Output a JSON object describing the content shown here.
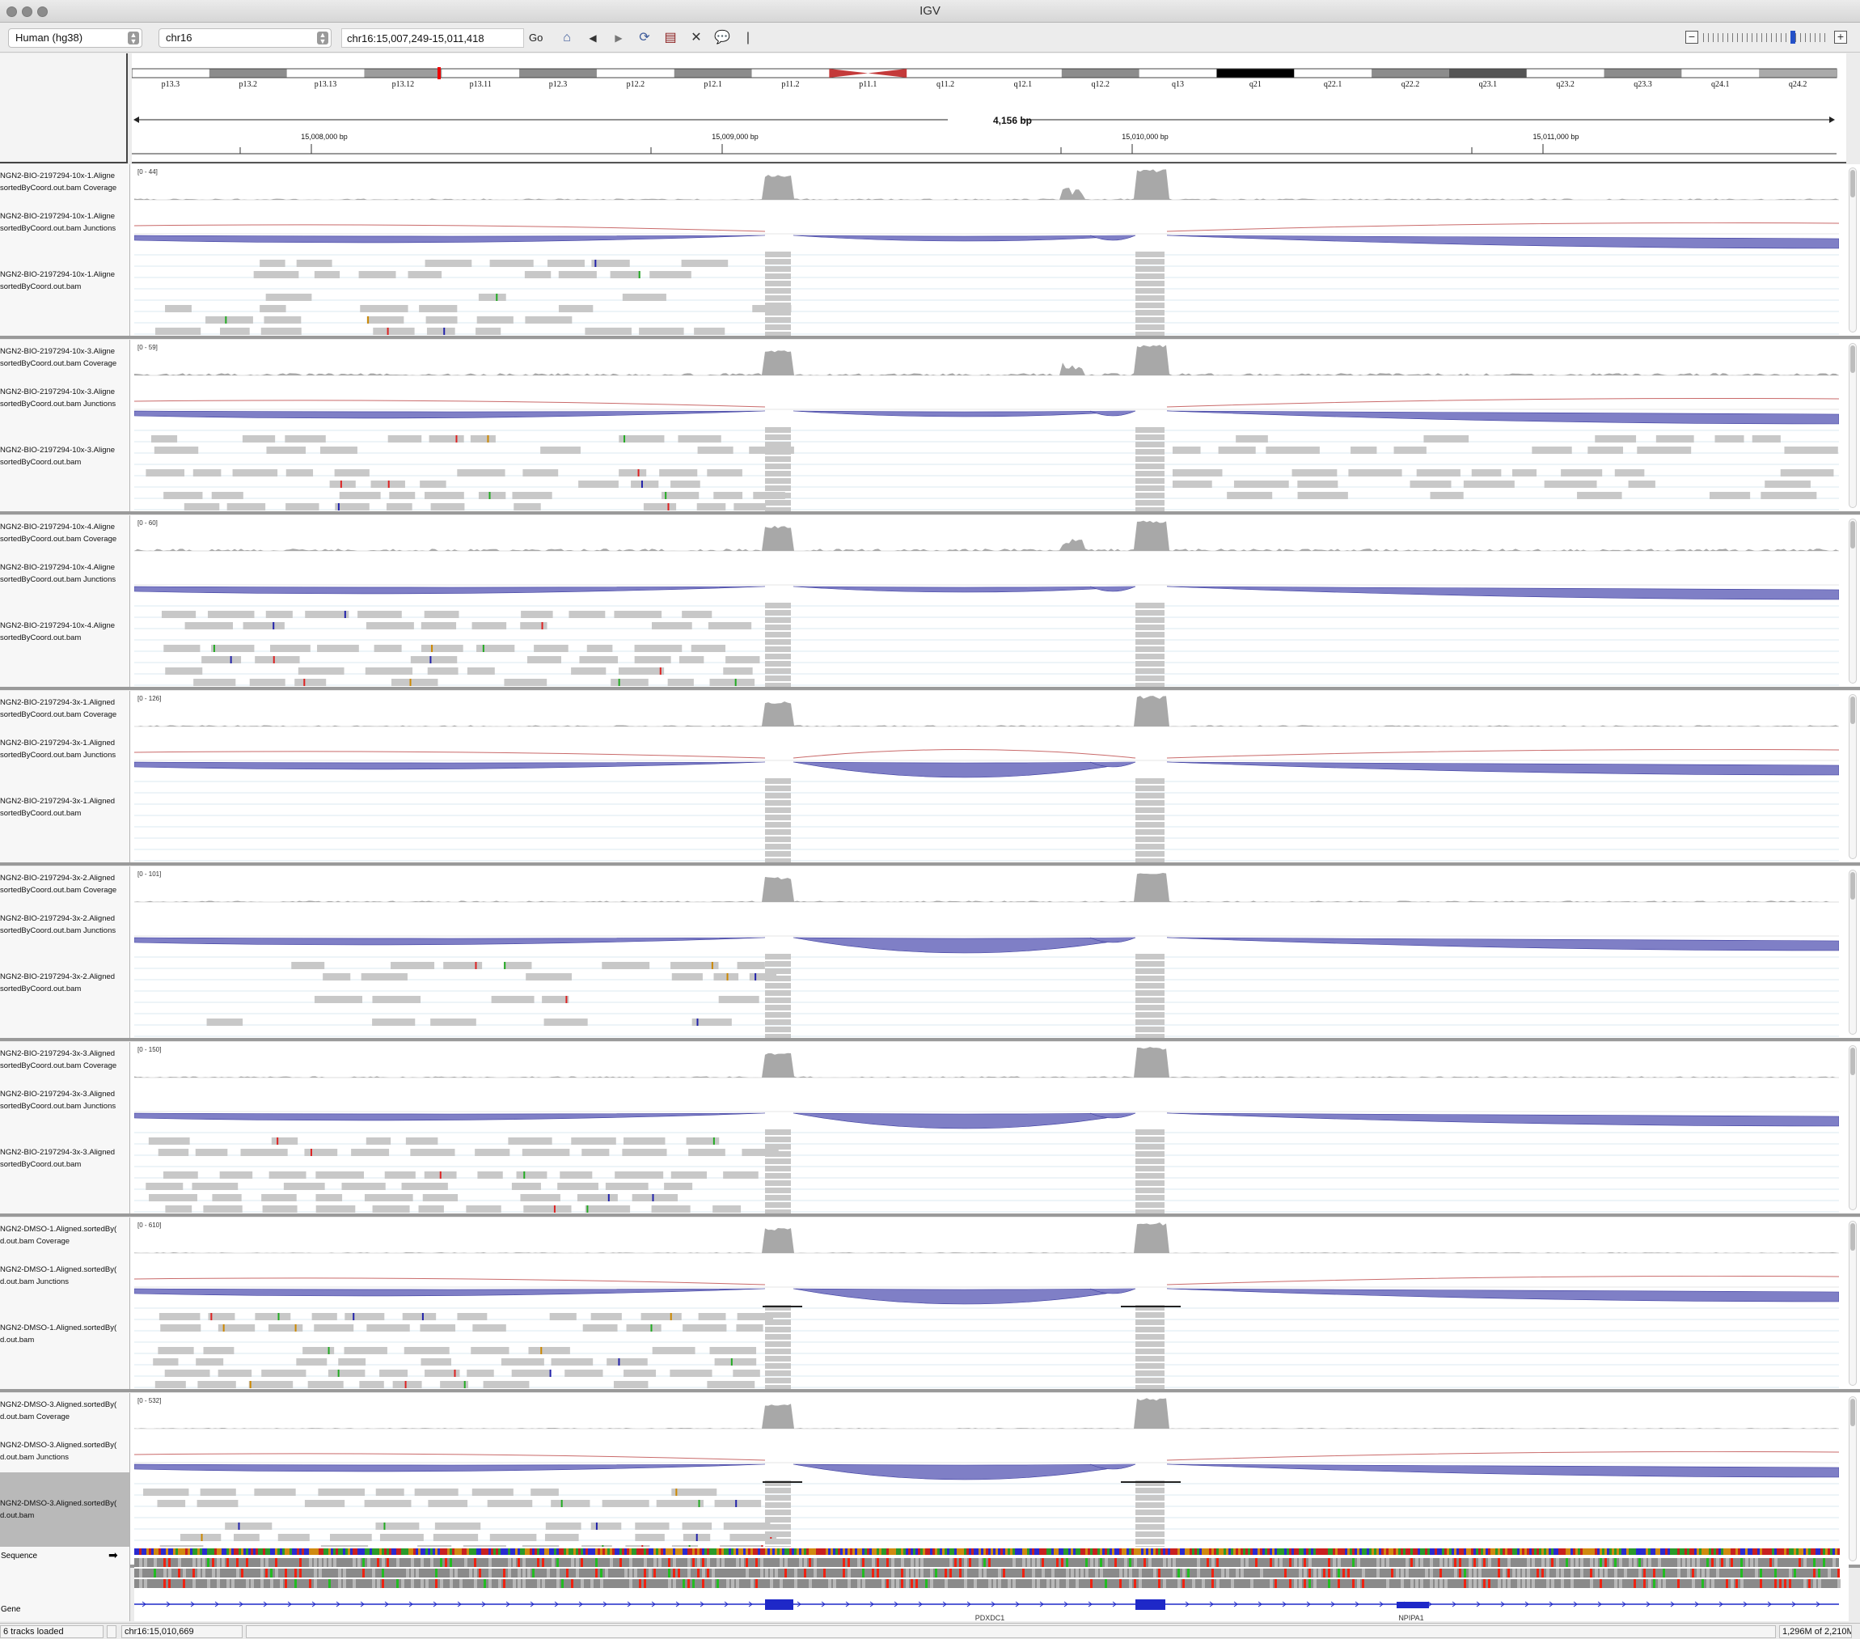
{
  "window": {
    "title": "IGV"
  },
  "toolbar": {
    "genome": "Human (hg38)",
    "chromosome": "chr16",
    "locus": "chr16:15,007,249-15,011,418",
    "go_label": "Go"
  },
  "ideogram": {
    "bands": [
      "p13.3",
      "p13.2",
      "p13.13",
      "p13.12",
      "p13.11",
      "p12.3",
      "p12.2",
      "p12.1",
      "p11.2",
      "p11.1",
      "q11.2",
      "q12.1",
      "q12.2",
      "q13",
      "q21",
      "q22.1",
      "q22.2",
      "q23.1",
      "q23.2",
      "q23.3",
      "q24.1",
      "q24.2"
    ],
    "span_label": "4,156 bp",
    "ticks": [
      "15,008,000 bp",
      "15,009,000 bp",
      "15,010,000 bp",
      "15,011,000 bp"
    ]
  },
  "panels": [
    {
      "range": "[0 - 44]",
      "coverage_name": [
        "NGN2-BIO-2197294-10x-1.Aligne",
        "sortedByCoord.out.bam Coverage"
      ],
      "junctions_name": [
        "NGN2-BIO-2197294-10x-1.Aligne",
        "sortedByCoord.out.bam Junctions"
      ],
      "bam_name": [
        "NGN2-BIO-2197294-10x-1.Aligne",
        "sortedByCoord.out.bam"
      ]
    },
    {
      "range": "[0 - 59]",
      "coverage_name": [
        "NGN2-BIO-2197294-10x-3.Aligne",
        "sortedByCoord.out.bam Coverage"
      ],
      "junctions_name": [
        "NGN2-BIO-2197294-10x-3.Aligne",
        "sortedByCoord.out.bam Junctions"
      ],
      "bam_name": [
        "NGN2-BIO-2197294-10x-3.Aligne",
        "sortedByCoord.out.bam"
      ]
    },
    {
      "range": "[0 - 60]",
      "coverage_name": [
        "NGN2-BIO-2197294-10x-4.Aligne",
        "sortedByCoord.out.bam Coverage"
      ],
      "junctions_name": [
        "NGN2-BIO-2197294-10x-4.Aligne",
        "sortedByCoord.out.bam Junctions"
      ],
      "bam_name": [
        "NGN2-BIO-2197294-10x-4.Aligne",
        "sortedByCoord.out.bam"
      ]
    },
    {
      "range": "[0 - 126]",
      "coverage_name": [
        "NGN2-BIO-2197294-3x-1.Aligned",
        "sortedByCoord.out.bam Coverage"
      ],
      "junctions_name": [
        "NGN2-BIO-2197294-3x-1.Aligned",
        "sortedByCoord.out.bam Junctions"
      ],
      "bam_name": [
        "NGN2-BIO-2197294-3x-1.Aligned",
        "sortedByCoord.out.bam"
      ]
    },
    {
      "range": "[0 - 101]",
      "coverage_name": [
        "NGN2-BIO-2197294-3x-2.Aligned",
        "sortedByCoord.out.bam Coverage"
      ],
      "junctions_name": [
        "NGN2-BIO-2197294-3x-2.Aligned",
        "sortedByCoord.out.bam Junctions"
      ],
      "bam_name": [
        "NGN2-BIO-2197294-3x-2.Aligned",
        "sortedByCoord.out.bam"
      ]
    },
    {
      "range": "[0 - 150]",
      "coverage_name": [
        "NGN2-BIO-2197294-3x-3.Aligned",
        "sortedByCoord.out.bam Coverage"
      ],
      "junctions_name": [
        "NGN2-BIO-2197294-3x-3.Aligned",
        "sortedByCoord.out.bam Junctions"
      ],
      "bam_name": [
        "NGN2-BIO-2197294-3x-3.Aligned",
        "sortedByCoord.out.bam"
      ]
    },
    {
      "range": "[0 - 610]",
      "coverage_name": [
        "NGN2-DMSO-1.Aligned.sortedBy(",
        "d.out.bam Coverage"
      ],
      "junctions_name": [
        "NGN2-DMSO-1.Aligned.sortedBy(",
        "d.out.bam Junctions"
      ],
      "bam_name": [
        "NGN2-DMSO-1.Aligned.sortedBy(",
        "d.out.bam"
      ]
    },
    {
      "range": "[0 - 532]",
      "coverage_name": [
        "NGN2-DMSO-3.Aligned.sortedBy(",
        "d.out.bam Coverage"
      ],
      "junctions_name": [
        "NGN2-DMSO-3.Aligned.sortedBy(",
        "d.out.bam Junctions"
      ],
      "bam_name": [
        "NGN2-DMSO-3.Aligned.sortedBy(",
        "d.out.bam"
      ]
    }
  ],
  "features": {
    "sequence_label": "Sequence",
    "gene_label": "Gene",
    "gene_names": [
      "PDXDC1",
      "NPIPA1"
    ]
  },
  "status": {
    "tracks_loaded": "6 tracks loaded",
    "position": "chr16:15,010,669",
    "memory": "1,296M of 2,210M"
  },
  "colors": {
    "coverage": "#a8a8a8",
    "junction_fill": "#7f7fc6",
    "junction_stroke": "#3a3a9e",
    "junction_neg": "#c96a6a",
    "read": "#c8c8c8",
    "gene": "#1e28c8"
  }
}
